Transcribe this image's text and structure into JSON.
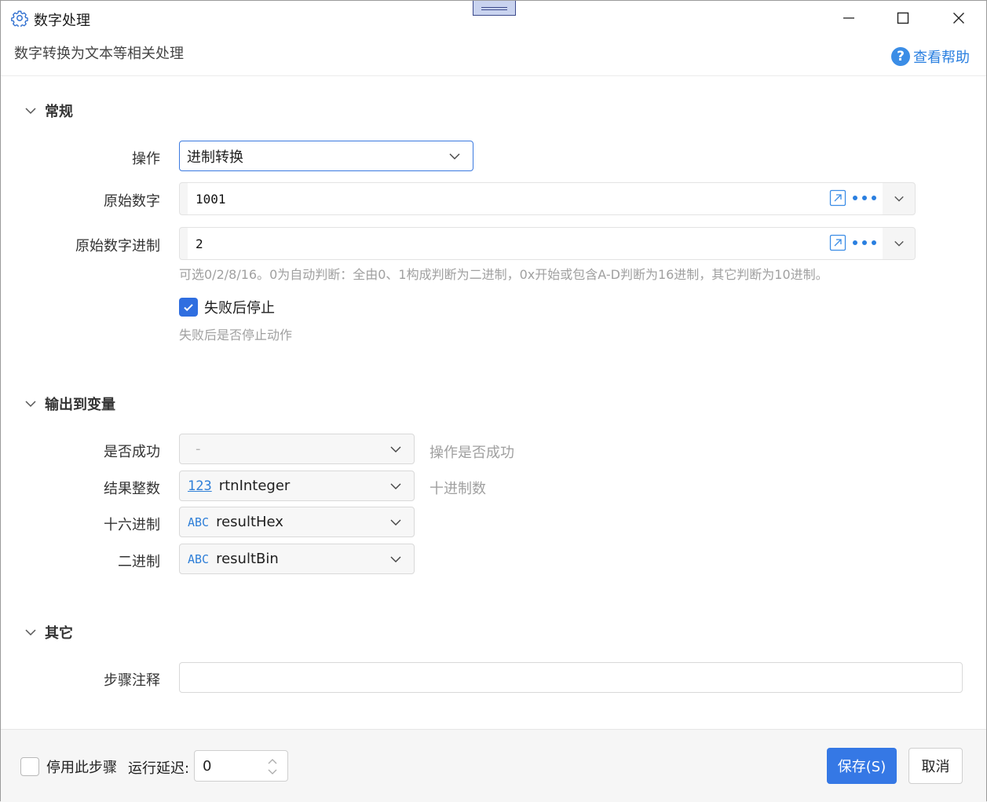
{
  "window": {
    "title": "数字处理",
    "subtitle": "数字转换为文本等相关处理",
    "help_label": "查看帮助",
    "help_glyph": "?"
  },
  "sections": {
    "general": {
      "title": "常规"
    },
    "output": {
      "title": "输出到变量"
    },
    "other": {
      "title": "其它"
    }
  },
  "general": {
    "operation": {
      "label": "操作",
      "value": "进制转换"
    },
    "source_number": {
      "label": "原始数字",
      "value": "1001"
    },
    "source_radix": {
      "label": "原始数字进制",
      "value": "2",
      "hint": "可选0/2/8/16。0为自动判断：全由0、1构成判断为二进制，0x开始或包含A-D判断为16进制，其它判断为10进制。"
    },
    "stop_on_fail": {
      "label": "失败后停止",
      "checked": true,
      "hint": "失败后是否停止动作"
    }
  },
  "output": {
    "success": {
      "label": "是否成功",
      "value": "-",
      "note": "操作是否成功"
    },
    "result_int": {
      "label": "结果整数",
      "type_badge": "123",
      "value": "rtnInteger",
      "note": "十进制数"
    },
    "hex": {
      "label": "十六进制",
      "type_badge": "ABC",
      "value": "resultHex"
    },
    "bin": {
      "label": "二进制",
      "type_badge": "ABC",
      "value": "resultBin"
    }
  },
  "other": {
    "step_note": {
      "label": "步骤注释",
      "value": ""
    }
  },
  "footer": {
    "disable_step": {
      "label": "停用此步骤",
      "checked": false
    },
    "delay_label": "运行延迟:",
    "delay_value": "0",
    "save_label": "保存(S)",
    "cancel_label": "取消"
  },
  "colors": {
    "accent": "#3578e5",
    "link": "#2a7fe0",
    "hint_text": "#a0a0a0"
  }
}
